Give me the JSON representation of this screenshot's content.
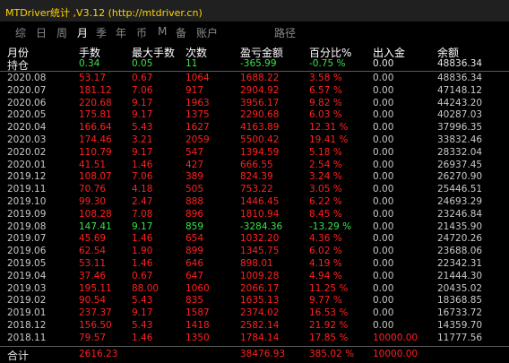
{
  "window": {
    "title": "MTDriver统计 ,V3.12 (http://mtdriver.cn)"
  },
  "tabs": [
    {
      "label": "综",
      "active": false
    },
    {
      "label": "日",
      "active": false
    },
    {
      "label": "周",
      "active": false
    },
    {
      "label": "月",
      "active": true
    },
    {
      "label": "季",
      "active": false
    },
    {
      "label": "年",
      "active": false
    },
    {
      "label": "币",
      "active": false
    },
    {
      "label": "M",
      "active": false
    },
    {
      "label": "备",
      "active": false
    },
    {
      "label": "账户",
      "active": false
    },
    {
      "label": "路径",
      "active": false
    }
  ],
  "table": {
    "headers": [
      "月份",
      "手数",
      "最大手数",
      "次数",
      "盈亏金额",
      "百分比%",
      "出入金",
      "余额"
    ],
    "holding": {
      "month": "持仓",
      "lots": "0.34",
      "max_lots": "0.05",
      "count": "11",
      "pnl": "-365.99",
      "pct": "-0.75 %",
      "inout": "0.00",
      "balance": "48836.34"
    },
    "rows": [
      {
        "month": "2020.08",
        "lots": "53.17",
        "max_lots": "0.67",
        "count": "1064",
        "pnl": "1688.22",
        "pct": "3.58 %",
        "inout": "0.00",
        "balance": "48836.34",
        "color": "red"
      },
      {
        "month": "2020.07",
        "lots": "181.12",
        "max_lots": "7.06",
        "count": "917",
        "pnl": "2904.92",
        "pct": "6.57 %",
        "inout": "0.00",
        "balance": "47148.12",
        "color": "red"
      },
      {
        "month": "2020.06",
        "lots": "220.68",
        "max_lots": "9.17",
        "count": "1963",
        "pnl": "3956.17",
        "pct": "9.82 %",
        "inout": "0.00",
        "balance": "44243.20",
        "color": "red"
      },
      {
        "month": "2020.05",
        "lots": "175.81",
        "max_lots": "9.17",
        "count": "1375",
        "pnl": "2290.68",
        "pct": "6.03 %",
        "inout": "0.00",
        "balance": "40287.03",
        "color": "red"
      },
      {
        "month": "2020.04",
        "lots": "166.64",
        "max_lots": "5.43",
        "count": "1627",
        "pnl": "4163.89",
        "pct": "12.31 %",
        "inout": "0.00",
        "balance": "37996.35",
        "color": "red"
      },
      {
        "month": "2020.03",
        "lots": "174.46",
        "max_lots": "3.21",
        "count": "2059",
        "pnl": "5500.42",
        "pct": "19.41 %",
        "inout": "0.00",
        "balance": "33832.46",
        "color": "red"
      },
      {
        "month": "2020.02",
        "lots": "110.79",
        "max_lots": "9.17",
        "count": "547",
        "pnl": "1394.59",
        "pct": "5.18 %",
        "inout": "0.00",
        "balance": "28332.04",
        "color": "red"
      },
      {
        "month": "2020.01",
        "lots": "41.51",
        "max_lots": "1.46",
        "count": "427",
        "pnl": "666.55",
        "pct": "2.54 %",
        "inout": "0.00",
        "balance": "26937.45",
        "color": "red"
      },
      {
        "month": "2019.12",
        "lots": "108.07",
        "max_lots": "7.06",
        "count": "389",
        "pnl": "824.39",
        "pct": "3.24 %",
        "inout": "0.00",
        "balance": "26270.90",
        "color": "red"
      },
      {
        "month": "2019.11",
        "lots": "70.76",
        "max_lots": "4.18",
        "count": "505",
        "pnl": "753.22",
        "pct": "3.05 %",
        "inout": "0.00",
        "balance": "25446.51",
        "color": "red"
      },
      {
        "month": "2019.10",
        "lots": "99.30",
        "max_lots": "2.47",
        "count": "888",
        "pnl": "1446.45",
        "pct": "6.22 %",
        "inout": "0.00",
        "balance": "24693.29",
        "color": "red"
      },
      {
        "month": "2019.09",
        "lots": "108.28",
        "max_lots": "7.08",
        "count": "896",
        "pnl": "1810.94",
        "pct": "8.45 %",
        "inout": "0.00",
        "balance": "23246.84",
        "color": "red"
      },
      {
        "month": "2019.08",
        "lots": "147.41",
        "max_lots": "9.17",
        "count": "859",
        "pnl": "-3284.36",
        "pct": "-13.29 %",
        "inout": "0.00",
        "balance": "21435.90",
        "color": "green"
      },
      {
        "month": "2019.07",
        "lots": "45.69",
        "max_lots": "1.46",
        "count": "654",
        "pnl": "1032.20",
        "pct": "4.36 %",
        "inout": "0.00",
        "balance": "24720.26",
        "color": "red"
      },
      {
        "month": "2019.06",
        "lots": "62.54",
        "max_lots": "1.90",
        "count": "899",
        "pnl": "1345.75",
        "pct": "6.02 %",
        "inout": "0.00",
        "balance": "23688.06",
        "color": "red"
      },
      {
        "month": "2019.05",
        "lots": "53.11",
        "max_lots": "1.46",
        "count": "646",
        "pnl": "898.01",
        "pct": "4.19 %",
        "inout": "0.00",
        "balance": "22342.31",
        "color": "red"
      },
      {
        "month": "2019.04",
        "lots": "37.46",
        "max_lots": "0.67",
        "count": "647",
        "pnl": "1009.28",
        "pct": "4.94 %",
        "inout": "0.00",
        "balance": "21444.30",
        "color": "red"
      },
      {
        "month": "2019.03",
        "lots": "195.11",
        "max_lots": "88.00",
        "count": "1060",
        "pnl": "2066.17",
        "pct": "11.25 %",
        "inout": "0.00",
        "balance": "20435.02",
        "color": "red"
      },
      {
        "month": "2019.02",
        "lots": "90.54",
        "max_lots": "5.43",
        "count": "835",
        "pnl": "1635.13",
        "pct": "9.77 %",
        "inout": "0.00",
        "balance": "18368.85",
        "color": "red"
      },
      {
        "month": "2019.01",
        "lots": "237.37",
        "max_lots": "9.17",
        "count": "1587",
        "pnl": "2374.02",
        "pct": "16.53 %",
        "inout": "0.00",
        "balance": "16733.72",
        "color": "red"
      },
      {
        "month": "2018.12",
        "lots": "156.50",
        "max_lots": "5.43",
        "count": "1418",
        "pnl": "2582.14",
        "pct": "21.92 %",
        "inout": "0.00",
        "balance": "14359.70",
        "color": "red"
      },
      {
        "month": "2018.11",
        "lots": "79.57",
        "max_lots": "1.46",
        "count": "1350",
        "pnl": "1784.14",
        "pct": "17.85 %",
        "inout": "10000.00",
        "balance": "11777.56",
        "color": "red"
      }
    ],
    "total": {
      "month": "合计",
      "lots": "2616.23",
      "max_lots": "",
      "count": "",
      "pnl": "38476.93",
      "pct": "385.02 %",
      "inout": "10000.00",
      "balance": ""
    }
  },
  "colors": {
    "accent": "#ffd400",
    "positive": "#ff2020",
    "negative": "#3ee04a",
    "background": "#000000"
  }
}
